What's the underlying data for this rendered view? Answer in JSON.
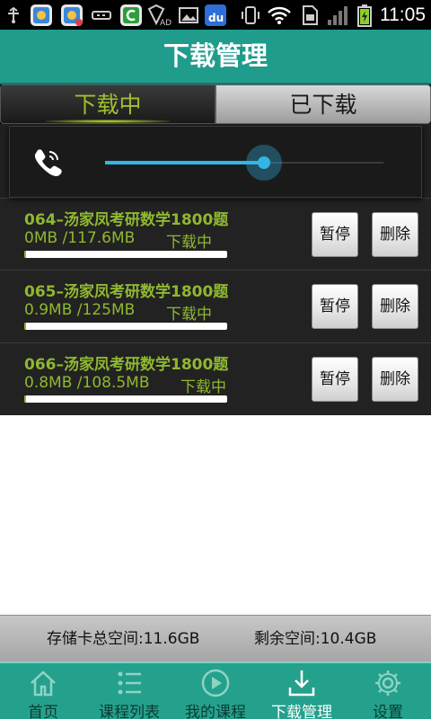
{
  "status_bar": {
    "time": "11:05",
    "icons": [
      "usb-icon",
      "app-notification-icon",
      "app-notification-icon",
      "usb-debug-icon",
      "green-app-icon",
      "av-shield-icon",
      "image-icon",
      "baidu-icon",
      "vibrate-icon",
      "wifi-icon",
      "sim-icon",
      "signal-icon",
      "battery-icon"
    ],
    "badges": {
      "baidu": "du",
      "av": "AD"
    }
  },
  "header": {
    "title": "下载管理"
  },
  "tabs": [
    {
      "label": "下载中",
      "active": true
    },
    {
      "label": "已下载",
      "active": false
    }
  ],
  "volume": {
    "icon": "phone-volume-icon",
    "level": 0.57
  },
  "downloads": [
    {
      "title": "064–汤家凤考研数学1800题",
      "size": "0MB /117.6MB",
      "status": "下载中",
      "progress": 0.0,
      "pause_label": "暂停",
      "delete_label": "删除"
    },
    {
      "title": "065–汤家凤考研数学1800题",
      "size": "0.9MB /125MB",
      "status": "下载中",
      "progress": 0.007,
      "pause_label": "暂停",
      "delete_label": "删除"
    },
    {
      "title": "066–汤家凤考研数学1800题",
      "size": "0.8MB /108.5MB",
      "status": "下载中",
      "progress": 0.007,
      "pause_label": "暂停",
      "delete_label": "删除"
    }
  ],
  "storage": {
    "total": "存储卡总空间:11.6GB",
    "free": "剩余空间:10.4GB"
  },
  "nav": [
    {
      "label": "首页",
      "icon": "home-icon",
      "active": false
    },
    {
      "label": "课程列表",
      "icon": "list-icon",
      "active": false
    },
    {
      "label": "我的课程",
      "icon": "play-circle-icon",
      "active": false
    },
    {
      "label": "下载管理",
      "icon": "download-icon",
      "active": true
    },
    {
      "label": "设置",
      "icon": "gear-icon",
      "active": false
    }
  ],
  "colors": {
    "header": "#1f9c8c",
    "accent_green": "#8fb830",
    "volume_blue": "#33b5e5",
    "nav_bg": "#24a18c"
  }
}
